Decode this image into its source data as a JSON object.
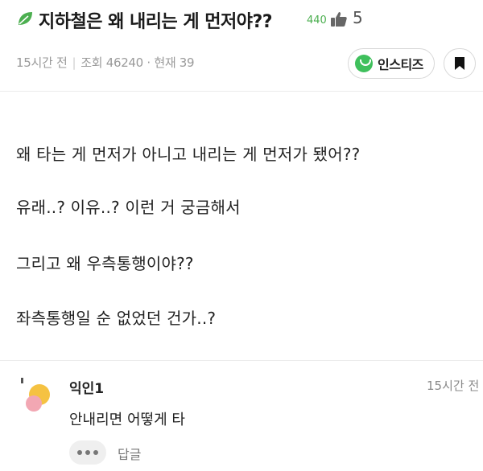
{
  "post": {
    "title": "지하철은 왜 내리는 게 먼저야??",
    "title_count": "440",
    "like_count": "5",
    "meta": {
      "time": "15시간 전",
      "views": "조회 46240",
      "current": "· 현재 39"
    },
    "insti_label": "인스티즈",
    "body": [
      "왜 타는 게 먼저가 아니고 내리는 게 먼저가 됐어??",
      "유래..? 이유..? 이런 거 궁금해서",
      "그리고 왜 우측통행이야??",
      "좌측통행일 순 없었던 건가..?"
    ]
  },
  "comment": {
    "author": "익인1",
    "time": "15시간 전",
    "text": "안내리면 어떻게 타",
    "reply_label": "답글",
    "more_icon": "more-dots-icon"
  },
  "colors": {
    "accent_green": "#3fc05c",
    "count_green": "#4caf50",
    "text": "#222222",
    "muted": "#9a9a9a"
  }
}
